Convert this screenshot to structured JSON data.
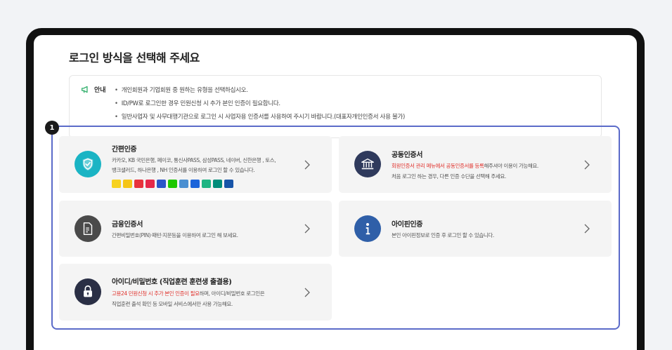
{
  "page": {
    "title": "로그인 방식을 선택해 주세요"
  },
  "notice": {
    "label": "안내",
    "items": [
      "개인회원과 기업회원 중 원하는 유형을 선택하십시오.",
      "ID/PW로 로그인한 경우 민원신청 시 추가 본인 인증이 필요합니다.",
      "일반사업자 및 사무대행기관으로 로그인 시 사업자용 인증서를 사용하여 주시기 바랍니다.(대표자개인인증서 사용 불가)"
    ]
  },
  "step_badge": "1",
  "cards": {
    "simple": {
      "title": "간편인증",
      "desc_line1": "카카오, KB 국민은행, 페이코, 통신사PASS, 삼성PASS, 네이버, 신한은행 , 토스,",
      "desc_line2": "뱅크샐러드, 하나은행 , NH 인증서를 이용하여 로그인 할 수 있습니다.",
      "icon": "shield-check-icon",
      "icon_color": "#1ab4c4",
      "providers": [
        {
          "name": "kakao",
          "color": "#f7d21f"
        },
        {
          "name": "kb",
          "color": "#f5c518"
        },
        {
          "name": "payco",
          "color": "#e8323c"
        },
        {
          "name": "pass",
          "color": "#e6294a"
        },
        {
          "name": "samsung-pass",
          "color": "#2b55c9"
        },
        {
          "name": "naver",
          "color": "#1ec800"
        },
        {
          "name": "shinhan",
          "color": "#4a8fd1"
        },
        {
          "name": "toss",
          "color": "#1b64da"
        },
        {
          "name": "banksalad",
          "color": "#1fb583"
        },
        {
          "name": "hana",
          "color": "#008d7a"
        },
        {
          "name": "nh",
          "color": "#1754a8"
        }
      ]
    },
    "joint_cert": {
      "title": "공동인증서",
      "desc_red": "회원인증서 관리 메뉴에서 공동인증서를 등록",
      "desc_rest": "해주셔야 이용이 가능해요.",
      "desc_line2": "처음 로그인 하는 경우, 다른 인증 수단을 선택해 주세요.",
      "icon": "bank-icon",
      "icon_color": "#2f3a5c"
    },
    "financial_cert": {
      "title": "금융인증서",
      "desc_line1": "간편비밀번호(PIN)·패턴·지문등을 이용하여 로그인 해 보세요.",
      "icon": "document-icon",
      "icon_color": "#4a4a4a"
    },
    "ipin": {
      "title": "아이핀인증",
      "desc_line1": "본인 아이핀정보로 인증 후 로그인 할 수 있습니다.",
      "icon": "info-icon",
      "icon_color": "#2f5fa8"
    },
    "id_password": {
      "title": "아이디/비밀번호 (직업훈련 훈련생 출결용)",
      "desc_red": "고용24 민원신청 시 추가 본인 인증이 필요",
      "desc_rest": "하며, 아이디/비밀번호 로그인은",
      "desc_line2": "직업훈련 출석 확인 등 모바일 서비스에서만 사용 가능해요.",
      "icon": "lock-icon",
      "icon_color": "#2a2f45"
    }
  }
}
